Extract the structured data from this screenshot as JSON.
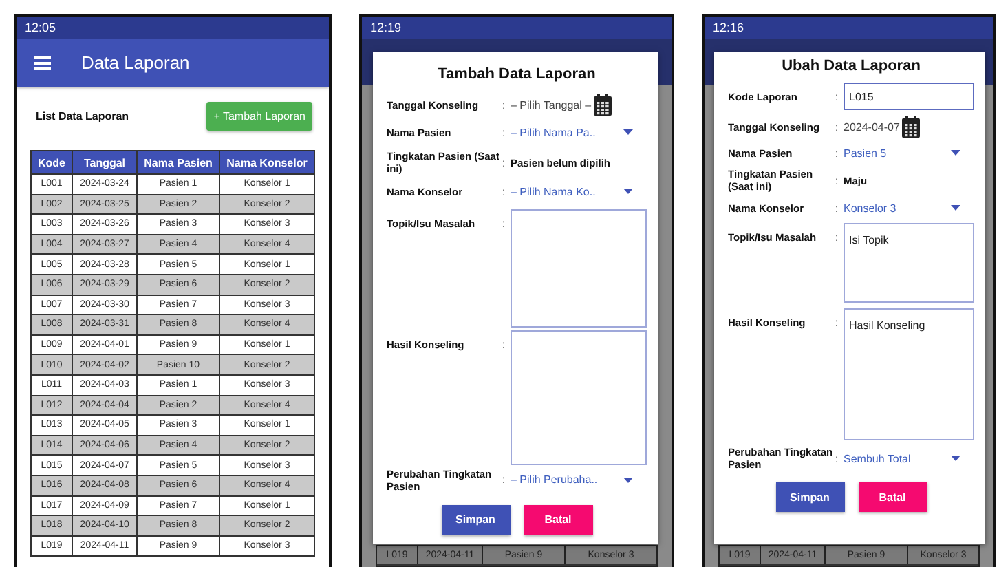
{
  "screens": [
    {
      "kind": "list",
      "status_time": "12:05",
      "app_bar": {
        "title": "Data Laporan"
      },
      "heading": "List Data Laporan",
      "add_button": "+ Tambah Laporan",
      "table": {
        "columns": [
          "Kode",
          "Tanggal",
          "Nama Pasien",
          "Nama Konselor"
        ],
        "rows": [
          [
            "L001",
            "2024-03-24",
            "Pasien 1",
            "Konselor 1"
          ],
          [
            "L002",
            "2024-03-25",
            "Pasien 2",
            "Konselor 2"
          ],
          [
            "L003",
            "2024-03-26",
            "Pasien 3",
            "Konselor 3"
          ],
          [
            "L004",
            "2024-03-27",
            "Pasien 4",
            "Konselor 4"
          ],
          [
            "L005",
            "2024-03-28",
            "Pasien 5",
            "Konselor 1"
          ],
          [
            "L006",
            "2024-03-29",
            "Pasien 6",
            "Konselor 2"
          ],
          [
            "L007",
            "2024-03-30",
            "Pasien 7",
            "Konselor 3"
          ],
          [
            "L008",
            "2024-03-31",
            "Pasien 8",
            "Konselor 4"
          ],
          [
            "L009",
            "2024-04-01",
            "Pasien 9",
            "Konselor 1"
          ],
          [
            "L010",
            "2024-04-02",
            "Pasien 10",
            "Konselor 2"
          ],
          [
            "L011",
            "2024-04-03",
            "Pasien 1",
            "Konselor 3"
          ],
          [
            "L012",
            "2024-04-04",
            "Pasien 2",
            "Konselor 4"
          ],
          [
            "L013",
            "2024-04-05",
            "Pasien 3",
            "Konselor 1"
          ],
          [
            "L014",
            "2024-04-06",
            "Pasien 4",
            "Konselor 2"
          ],
          [
            "L015",
            "2024-04-07",
            "Pasien 5",
            "Konselor 3"
          ],
          [
            "L016",
            "2024-04-08",
            "Pasien 6",
            "Konselor 4"
          ],
          [
            "L017",
            "2024-04-09",
            "Pasien 7",
            "Konselor 1"
          ],
          [
            "L018",
            "2024-04-10",
            "Pasien 8",
            "Konselor 2"
          ],
          [
            "L019",
            "2024-04-11",
            "Pasien 9",
            "Konselor 3"
          ]
        ]
      }
    },
    {
      "kind": "dialog",
      "status_time": "12:19",
      "dialog": {
        "title": "Tambah Data Laporan",
        "fields": [
          {
            "kind": "date",
            "label": "Tanggal Konseling",
            "separator": ":",
            "value": "– Pilih Tanggal –"
          },
          {
            "kind": "dropdown",
            "label": "Nama Pasien",
            "separator": ":",
            "value": "– Pilih Nama Pa.."
          },
          {
            "kind": "text",
            "label": "Tingkatan Pasien (Saat ini)",
            "separator": ":",
            "value": "Pasien belum dipilih"
          },
          {
            "kind": "dropdown",
            "label": "Nama Konselor",
            "separator": ":",
            "value": "– Pilih Nama Ko.."
          },
          {
            "kind": "textarea",
            "label": "Topik/Isu Masalah",
            "separator": ":"
          },
          {
            "kind": "textarea",
            "label": "Hasil Konseling",
            "separator": ":"
          },
          {
            "kind": "dropdown",
            "label": "Perubahan Tingkatan Pasien",
            "separator": ":",
            "value": "– Pilih Perubaha.."
          }
        ],
        "buttons": [
          {
            "kind": "save",
            "label": "Simpan"
          },
          {
            "kind": "cancel",
            "label": "Batal"
          }
        ]
      },
      "behind_row": [
        "L019",
        "2024-04-11",
        "Pasien 9",
        "Konselor 3"
      ]
    },
    {
      "kind": "dialog",
      "status_time": "12:16",
      "dialog": {
        "title": "Ubah Data Laporan",
        "fields": [
          {
            "kind": "input",
            "label": "Kode Laporan",
            "separator": ":",
            "value": "L015"
          },
          {
            "kind": "date",
            "label": "Tanggal Konseling",
            "separator": ":",
            "value": "2024-04-07"
          },
          {
            "kind": "dropdown",
            "label": "Nama Pasien",
            "separator": ":",
            "value": "Pasien 5"
          },
          {
            "kind": "text",
            "label": "Tingkatan Pasien (Saat ini)",
            "separator": ":",
            "value": "Maju"
          },
          {
            "kind": "dropdown",
            "label": "Nama Konselor",
            "separator": ":",
            "value": "Konselor 3"
          },
          {
            "kind": "textarea",
            "label": "Topik/Isu Masalah",
            "separator": ":",
            "value": "Isi Topik"
          },
          {
            "kind": "textarea",
            "label": "Hasil Konseling",
            "separator": ":",
            "value": "Hasil Konseling"
          },
          {
            "kind": "dropdown",
            "label": "Perubahan Tingkatan Pasien",
            "separator": ":",
            "value": "Sembuh Total"
          }
        ],
        "buttons": [
          {
            "kind": "save",
            "label": "Simpan"
          },
          {
            "kind": "cancel",
            "label": "Batal"
          }
        ]
      },
      "behind_row": [
        "L019",
        "2024-04-11",
        "Pasien 9",
        "Konselor 3"
      ]
    }
  ]
}
